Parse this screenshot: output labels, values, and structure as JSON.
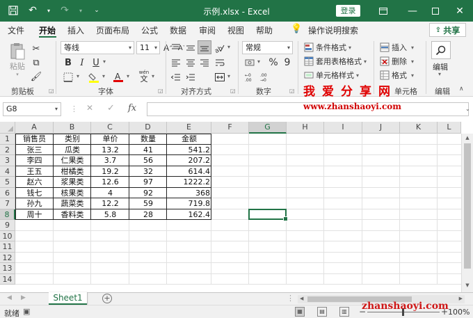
{
  "window": {
    "title": "示例.xlsx - Excel",
    "login": "登录"
  },
  "tabs": [
    {
      "label": "文件"
    },
    {
      "label": "开始"
    },
    {
      "label": "插入"
    },
    {
      "label": "页面布局"
    },
    {
      "label": "公式"
    },
    {
      "label": "数据"
    },
    {
      "label": "审阅"
    },
    {
      "label": "视图"
    },
    {
      "label": "帮助"
    },
    {
      "label": "操作说明搜索"
    }
  ],
  "share_label": "共享",
  "ribbon": {
    "paste_label": "粘贴",
    "groups": {
      "clipboard": "剪贴板",
      "font": "字体",
      "alignment": "对齐方式",
      "number": "数字",
      "cells": "单元格",
      "editing": "编辑"
    },
    "font_name": "等线",
    "font_size": "11",
    "bold": "B",
    "italic": "I",
    "underline": "U",
    "grow_font": "A",
    "shrink_font": "A",
    "wen_label": "wén",
    "wen_char": "文",
    "number_format": "常规",
    "percent": "%",
    "comma": "9",
    "cond_format": "条件格式",
    "table_format": "套用表格格式",
    "cell_style": "单元格样式",
    "insert": "插入",
    "delete": "删除",
    "format": "格式",
    "editing_label": "编辑",
    "watermark": "我爱分享网"
  },
  "formula_bar": {
    "name_box": "G8",
    "fx": "fx",
    "content": ""
  },
  "watermark_url": "www.zhanshaoyi.com",
  "watermark_url2": "zhanshaoyi.com",
  "grid": {
    "selected_cell": "G8",
    "columns": [
      "A",
      "B",
      "C",
      "D",
      "E",
      "F",
      "G",
      "H",
      "I",
      "J",
      "K",
      "L"
    ],
    "rows": [
      "1",
      "2",
      "3",
      "4",
      "5",
      "6",
      "7",
      "8",
      "9",
      "10",
      "11",
      "12",
      "13",
      "14"
    ],
    "header": [
      "销售员",
      "类别",
      "单价",
      "数量",
      "金额"
    ],
    "data": [
      [
        "张三",
        "瓜类",
        "13.2",
        "41",
        "541.2"
      ],
      [
        "李四",
        "仁果类",
        "3.7",
        "56",
        "207.2"
      ],
      [
        "王五",
        "柑橘类",
        "19.2",
        "32",
        "614.4"
      ],
      [
        "赵六",
        "浆果类",
        "12.6",
        "97",
        "1222.2"
      ],
      [
        "钱七",
        "核果类",
        "4",
        "92",
        "368"
      ],
      [
        "孙九",
        "蔬菜类",
        "12.2",
        "59",
        "719.8"
      ],
      [
        "周十",
        "香料类",
        "5.8",
        "28",
        "162.4"
      ]
    ]
  },
  "sheets": [
    {
      "label": "Sheet1"
    }
  ],
  "status": {
    "ready": "就绪",
    "zoom": "100%",
    "minus": "−",
    "plus": "+"
  }
}
